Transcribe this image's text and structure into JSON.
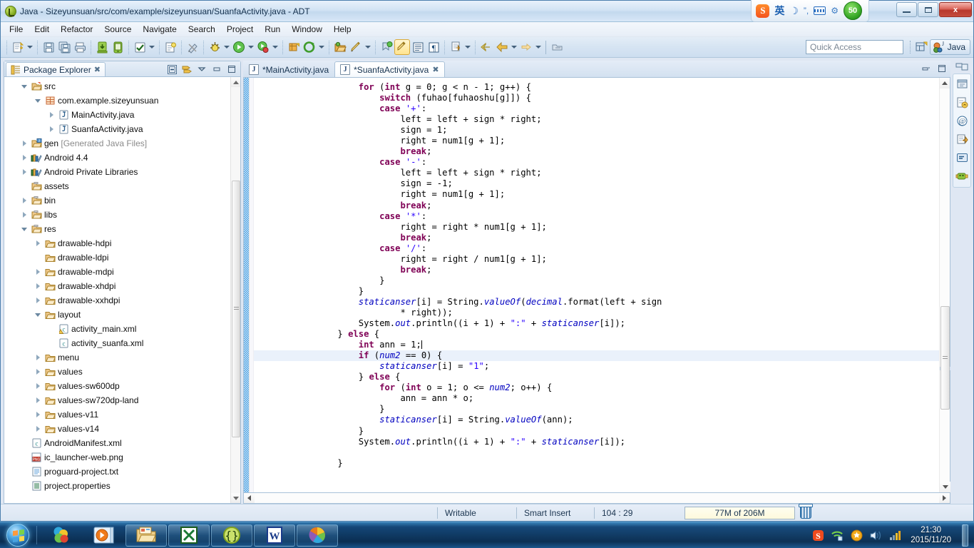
{
  "window": {
    "title": "Java - Sizeyunsuan/src/com/example/sizeyunsuan/SuanfaActivity.java - ADT",
    "icon": "eclipse-adt-icon",
    "minimize_label": "–",
    "restore_label": "❐",
    "close_label": "x"
  },
  "ime": {
    "logo": "S",
    "mode": "英",
    "moon": "☽",
    "punct": "”,",
    "keyboard_icon": "keyboard-icon",
    "toolbox_icon": "toolbox-icon",
    "badge": "50"
  },
  "menubar": {
    "items": [
      {
        "label": "File"
      },
      {
        "label": "Edit"
      },
      {
        "label": "Refactor"
      },
      {
        "label": "Source"
      },
      {
        "label": "Navigate"
      },
      {
        "label": "Search"
      },
      {
        "label": "Project"
      },
      {
        "label": "Run"
      },
      {
        "label": "Window"
      },
      {
        "label": "Help"
      }
    ]
  },
  "toolbar": {
    "quick_access_placeholder": "Quick Access",
    "perspective_label": "Java",
    "buttons": [
      {
        "name": "new-wizard-icon"
      },
      {
        "name": "save-icon"
      },
      {
        "name": "save-all-icon"
      },
      {
        "name": "print-icon"
      },
      {
        "name": "android-sdk-manager-icon"
      },
      {
        "name": "android-avd-manager-icon"
      },
      {
        "name": "build-all-icon"
      },
      {
        "name": "open-type-icon"
      },
      {
        "name": "lint-warnings-icon"
      },
      {
        "name": "debug-icon"
      },
      {
        "name": "run-icon"
      },
      {
        "name": "coverage-icon"
      },
      {
        "name": "new-android-project-icon"
      },
      {
        "name": "external-tools-icon"
      },
      {
        "name": "open-resource-icon"
      },
      {
        "name": "pencil-edit-icon"
      },
      {
        "name": "toggle-breakpoint-icon"
      },
      {
        "name": "toggle-mark-occurrences-icon"
      },
      {
        "name": "show-whitespace-icon"
      },
      {
        "name": "show-pilcrow-icon"
      },
      {
        "name": "next-annotation-icon"
      },
      {
        "name": "last-edit-location-icon"
      },
      {
        "name": "back-icon"
      },
      {
        "name": "forward-icon"
      },
      {
        "name": "step-return-icon"
      },
      {
        "name": "pin-editor-icon"
      }
    ]
  },
  "package_explorer": {
    "tab_label": "Package Explorer",
    "tab_icon": "package-explorer-icon",
    "close_icon": "close-icon",
    "tools": [
      {
        "name": "collapse-all-icon"
      },
      {
        "name": "link-with-editor-icon"
      },
      {
        "name": "view-menu-icon"
      },
      {
        "name": "minimize-view-icon"
      },
      {
        "name": "maximize-view-icon"
      }
    ],
    "tree": [
      {
        "label": "src",
        "indent": 1,
        "twist": "open",
        "icon": "source-folder-icon"
      },
      {
        "label": "com.example.sizeyunsuan",
        "indent": 2,
        "twist": "open",
        "icon": "package-icon"
      },
      {
        "label": "MainActivity.java",
        "indent": 3,
        "twist": "closed",
        "icon": "java-file-icon"
      },
      {
        "label": "SuanfaActivity.java",
        "indent": 3,
        "twist": "closed",
        "icon": "java-file-icon"
      },
      {
        "label": "gen ",
        "label2": "[Generated Java Files]",
        "indent": 1,
        "twist": "closed",
        "icon": "gen-source-folder-icon"
      },
      {
        "label": "Android 4.4",
        "indent": 1,
        "twist": "closed",
        "icon": "library-icon"
      },
      {
        "label": "Android Private Libraries",
        "indent": 1,
        "twist": "closed",
        "icon": "library-icon"
      },
      {
        "label": "assets",
        "indent": 1,
        "twist": "none",
        "icon": "folder-plain-icon"
      },
      {
        "label": "bin",
        "indent": 1,
        "twist": "closed",
        "icon": "folder-plain-icon"
      },
      {
        "label": "libs",
        "indent": 1,
        "twist": "closed",
        "icon": "folder-plain-icon"
      },
      {
        "label": "res",
        "indent": 1,
        "twist": "open",
        "icon": "folder-plain-icon"
      },
      {
        "label": "drawable-hdpi",
        "indent": 2,
        "twist": "closed",
        "icon": "folder-icon"
      },
      {
        "label": "drawable-ldpi",
        "indent": 2,
        "twist": "none",
        "icon": "folder-icon"
      },
      {
        "label": "drawable-mdpi",
        "indent": 2,
        "twist": "closed",
        "icon": "folder-icon"
      },
      {
        "label": "drawable-xhdpi",
        "indent": 2,
        "twist": "closed",
        "icon": "folder-icon"
      },
      {
        "label": "drawable-xxhdpi",
        "indent": 2,
        "twist": "closed",
        "icon": "folder-icon"
      },
      {
        "label": "layout",
        "indent": 2,
        "twist": "open",
        "icon": "folder-icon"
      },
      {
        "label": "activity_main.xml",
        "indent": 3,
        "twist": "none",
        "icon": "xml-warning-file-icon"
      },
      {
        "label": "activity_suanfa.xml",
        "indent": 3,
        "twist": "none",
        "icon": "xml-file-icon"
      },
      {
        "label": "menu",
        "indent": 2,
        "twist": "closed",
        "icon": "folder-icon"
      },
      {
        "label": "values",
        "indent": 2,
        "twist": "closed",
        "icon": "folder-icon"
      },
      {
        "label": "values-sw600dp",
        "indent": 2,
        "twist": "closed",
        "icon": "folder-icon"
      },
      {
        "label": "values-sw720dp-land",
        "indent": 2,
        "twist": "closed",
        "icon": "folder-icon"
      },
      {
        "label": "values-v11",
        "indent": 2,
        "twist": "closed",
        "icon": "folder-icon"
      },
      {
        "label": "values-v14",
        "indent": 2,
        "twist": "closed",
        "icon": "folder-icon"
      },
      {
        "label": "AndroidManifest.xml",
        "indent": 1,
        "twist": "none",
        "icon": "xml-file-icon"
      },
      {
        "label": "ic_launcher-web.png",
        "indent": 1,
        "twist": "none",
        "icon": "png-file-icon"
      },
      {
        "label": "proguard-project.txt",
        "indent": 1,
        "twist": "none",
        "icon": "text-file-icon"
      },
      {
        "label": "project.properties",
        "indent": 1,
        "twist": "none",
        "icon": "properties-file-icon"
      }
    ]
  },
  "editor": {
    "tabs": [
      {
        "label": "*MainActivity.java",
        "active": false,
        "icon": "java-file-icon",
        "closeable": false
      },
      {
        "label": "*SuanfaActivity.java",
        "active": true,
        "icon": "java-file-icon",
        "closeable": true,
        "close_icon": "close-icon"
      }
    ],
    "tab_tools": [
      {
        "name": "minimize-editor-icon"
      },
      {
        "name": "maximize-editor-icon"
      }
    ],
    "highlighted_line_index": 25,
    "code_lines": [
      [
        {
          "t": "                    ",
          "c": ""
        },
        {
          "t": "for",
          "c": "k"
        },
        {
          "t": " (",
          "c": ""
        },
        {
          "t": "int",
          "c": "k"
        },
        {
          "t": " g = 0; g < n - 1; g++) {",
          "c": ""
        }
      ],
      [
        {
          "t": "                        ",
          "c": ""
        },
        {
          "t": "switch",
          "c": "k"
        },
        {
          "t": " (fuhao[fuhaoshu[g]]) {",
          "c": ""
        }
      ],
      [
        {
          "t": "                        ",
          "c": ""
        },
        {
          "t": "case",
          "c": "k"
        },
        {
          "t": " ",
          "c": ""
        },
        {
          "t": "'+'",
          "c": "s"
        },
        {
          "t": ":",
          "c": ""
        }
      ],
      [
        {
          "t": "                            left = left + sign * right;",
          "c": ""
        }
      ],
      [
        {
          "t": "                            sign = 1;",
          "c": ""
        }
      ],
      [
        {
          "t": "                            right = num1[g + 1];",
          "c": ""
        }
      ],
      [
        {
          "t": "                            ",
          "c": ""
        },
        {
          "t": "break",
          "c": "k"
        },
        {
          "t": ";",
          "c": ""
        }
      ],
      [
        {
          "t": "                        ",
          "c": ""
        },
        {
          "t": "case",
          "c": "k"
        },
        {
          "t": " ",
          "c": ""
        },
        {
          "t": "'-'",
          "c": "s"
        },
        {
          "t": ":",
          "c": ""
        }
      ],
      [
        {
          "t": "                            left = left + sign * right;",
          "c": ""
        }
      ],
      [
        {
          "t": "                            sign = -1;",
          "c": ""
        }
      ],
      [
        {
          "t": "                            right = num1[g + 1];",
          "c": ""
        }
      ],
      [
        {
          "t": "                            ",
          "c": ""
        },
        {
          "t": "break",
          "c": "k"
        },
        {
          "t": ";",
          "c": ""
        }
      ],
      [
        {
          "t": "                        ",
          "c": ""
        },
        {
          "t": "case",
          "c": "k"
        },
        {
          "t": " ",
          "c": ""
        },
        {
          "t": "'*'",
          "c": "s"
        },
        {
          "t": ":",
          "c": ""
        }
      ],
      [
        {
          "t": "                            right = right * num1[g + 1];",
          "c": ""
        }
      ],
      [
        {
          "t": "                            ",
          "c": ""
        },
        {
          "t": "break",
          "c": "k"
        },
        {
          "t": ";",
          "c": ""
        }
      ],
      [
        {
          "t": "                        ",
          "c": ""
        },
        {
          "t": "case",
          "c": "k"
        },
        {
          "t": " ",
          "c": ""
        },
        {
          "t": "'/'",
          "c": "s"
        },
        {
          "t": ":",
          "c": ""
        }
      ],
      [
        {
          "t": "                            right = right / num1[g + 1];",
          "c": ""
        }
      ],
      [
        {
          "t": "                            ",
          "c": ""
        },
        {
          "t": "break",
          "c": "k"
        },
        {
          "t": ";",
          "c": ""
        }
      ],
      [
        {
          "t": "                        }",
          "c": ""
        }
      ],
      [
        {
          "t": "                    }",
          "c": ""
        }
      ],
      [
        {
          "t": "                    ",
          "c": ""
        },
        {
          "t": "staticanser",
          "c": "f"
        },
        {
          "t": "[i] = String.",
          "c": ""
        },
        {
          "t": "valueOf",
          "c": "f"
        },
        {
          "t": "(",
          "c": ""
        },
        {
          "t": "decimal",
          "c": "f"
        },
        {
          "t": ".format(left + sign",
          "c": ""
        }
      ],
      [
        {
          "t": "                            * right));",
          "c": ""
        }
      ],
      [
        {
          "t": "                    System.",
          "c": ""
        },
        {
          "t": "out",
          "c": "f"
        },
        {
          "t": ".println((i + 1) + ",
          "c": ""
        },
        {
          "t": "\":\"",
          "c": "s"
        },
        {
          "t": " + ",
          "c": ""
        },
        {
          "t": "staticanser",
          "c": "f"
        },
        {
          "t": "[i]);",
          "c": ""
        }
      ],
      [
        {
          "t": "                } ",
          "c": ""
        },
        {
          "t": "else",
          "c": "k"
        },
        {
          "t": " {",
          "c": ""
        }
      ],
      [
        {
          "t": "                    ",
          "c": ""
        },
        {
          "t": "int",
          "c": "k"
        },
        {
          "t": " ann = 1;",
          "c": ""
        },
        {
          "t": "|",
          "c": "caret"
        }
      ],
      [
        {
          "t": "                    ",
          "c": ""
        },
        {
          "t": "if",
          "c": "k"
        },
        {
          "t": " (",
          "c": ""
        },
        {
          "t": "num2",
          "c": "f"
        },
        {
          "t": " == 0) {",
          "c": ""
        }
      ],
      [
        {
          "t": "                        ",
          "c": ""
        },
        {
          "t": "staticanser",
          "c": "f"
        },
        {
          "t": "[i] = ",
          "c": ""
        },
        {
          "t": "\"1\"",
          "c": "s"
        },
        {
          "t": ";",
          "c": ""
        }
      ],
      [
        {
          "t": "                    } ",
          "c": ""
        },
        {
          "t": "else",
          "c": "k"
        },
        {
          "t": " {",
          "c": ""
        }
      ],
      [
        {
          "t": "                        ",
          "c": ""
        },
        {
          "t": "for",
          "c": "k"
        },
        {
          "t": " (",
          "c": ""
        },
        {
          "t": "int",
          "c": "k"
        },
        {
          "t": " o = 1; o <= ",
          "c": ""
        },
        {
          "t": "num2",
          "c": "f"
        },
        {
          "t": "; o++) {",
          "c": ""
        }
      ],
      [
        {
          "t": "                            ann = ann * o;",
          "c": ""
        }
      ],
      [
        {
          "t": "                        }",
          "c": ""
        }
      ],
      [
        {
          "t": "                        ",
          "c": ""
        },
        {
          "t": "staticanser",
          "c": "f"
        },
        {
          "t": "[i] = String.",
          "c": ""
        },
        {
          "t": "valueOf",
          "c": "f"
        },
        {
          "t": "(ann);",
          "c": ""
        }
      ],
      [
        {
          "t": "                    }",
          "c": ""
        }
      ],
      [
        {
          "t": "                    System.",
          "c": ""
        },
        {
          "t": "out",
          "c": "f"
        },
        {
          "t": ".println((i + 1) + ",
          "c": ""
        },
        {
          "t": "\":\"",
          "c": "s"
        },
        {
          "t": " + ",
          "c": ""
        },
        {
          "t": "staticanser",
          "c": "f"
        },
        {
          "t": "[i]);",
          "c": ""
        }
      ],
      [
        {
          "t": "",
          "c": ""
        }
      ],
      [
        {
          "t": "                }",
          "c": ""
        }
      ]
    ]
  },
  "fastview": {
    "icons": [
      {
        "name": "restore-view-icon"
      },
      {
        "name": "package-explorer-fastview-icon"
      },
      {
        "name": "javadoc-at-icon"
      },
      {
        "name": "declaration-view-icon"
      },
      {
        "name": "console-view-icon"
      },
      {
        "name": "logcat-view-icon"
      }
    ]
  },
  "statusbar": {
    "writable": "Writable",
    "insert_mode": "Smart Insert",
    "cursor_position": "104 : 29",
    "heap": "77M of 206M",
    "trash_icon": "trash-icon"
  },
  "taskbar": {
    "start_icon": "windows-start-orb",
    "items": [
      {
        "name": "taskbar-sogou-browser",
        "icon": "sogou-browser-icon"
      },
      {
        "name": "taskbar-media-player",
        "icon": "media-player-icon"
      },
      {
        "name": "taskbar-explorer",
        "icon": "folder-explorer-icon"
      },
      {
        "name": "taskbar-excel",
        "icon": "excel-icon"
      },
      {
        "name": "taskbar-eclipse",
        "icon": "braces-icon"
      },
      {
        "name": "taskbar-word",
        "icon": "word-icon"
      },
      {
        "name": "taskbar-chrome",
        "icon": "pinwheel-icon"
      }
    ],
    "tray": [
      {
        "name": "sogou-tray-icon",
        "glyph": "S"
      },
      {
        "name": "wifi-icon"
      },
      {
        "name": "security-shield-icon"
      },
      {
        "name": "volume-icon"
      },
      {
        "name": "network-signal-icon"
      }
    ],
    "time": "21:30",
    "date": "2015/11/20"
  },
  "colors": {
    "keyword": "#7f0055",
    "field": "#0000c0",
    "string": "#2a00ff",
    "highlight_line": "#eaf1fb",
    "chrome": "#d6e4f2",
    "taskbar": "#0c3b68"
  }
}
